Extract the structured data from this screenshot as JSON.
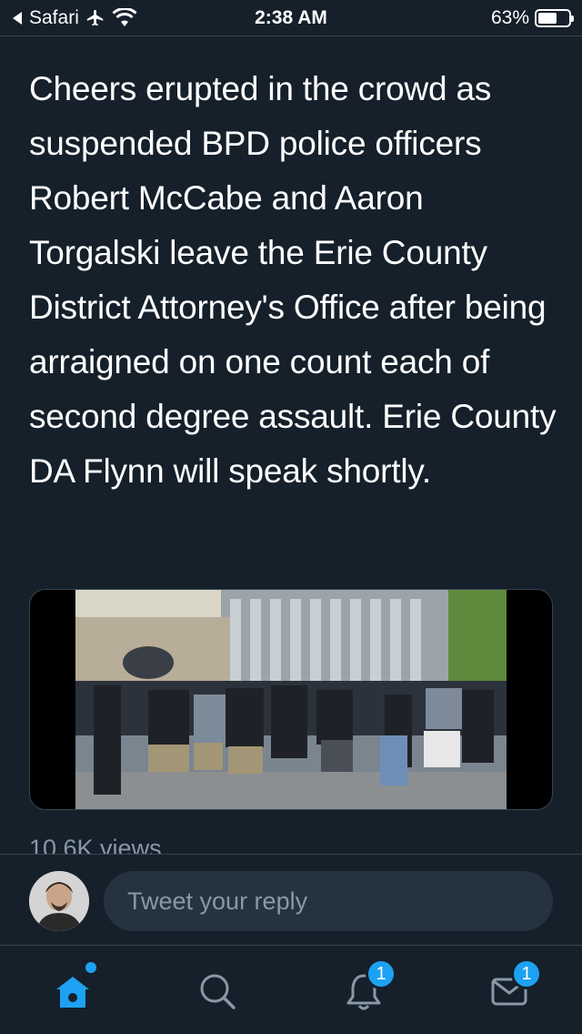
{
  "status_bar": {
    "back_app": "Safari",
    "time": "2:38 AM",
    "battery_percent": "63%",
    "battery_level": 0.63
  },
  "tweet": {
    "text": "Cheers erupted in the crowd as suspended BPD police officers Robert McCabe and Aaron Torgalski leave the Erie County District Attorney's Office after being arraigned on one count each of second degree assault. Erie County DA Flynn will speak shortly.",
    "views": "10.6K views"
  },
  "reply": {
    "placeholder": "Tweet your reply"
  },
  "tab_bar": {
    "notifications_badge": "1",
    "messages_badge": "1"
  },
  "colors": {
    "background": "#15202b",
    "accent": "#1da1f2",
    "muted": "#8899a6",
    "divider": "#38444d"
  }
}
